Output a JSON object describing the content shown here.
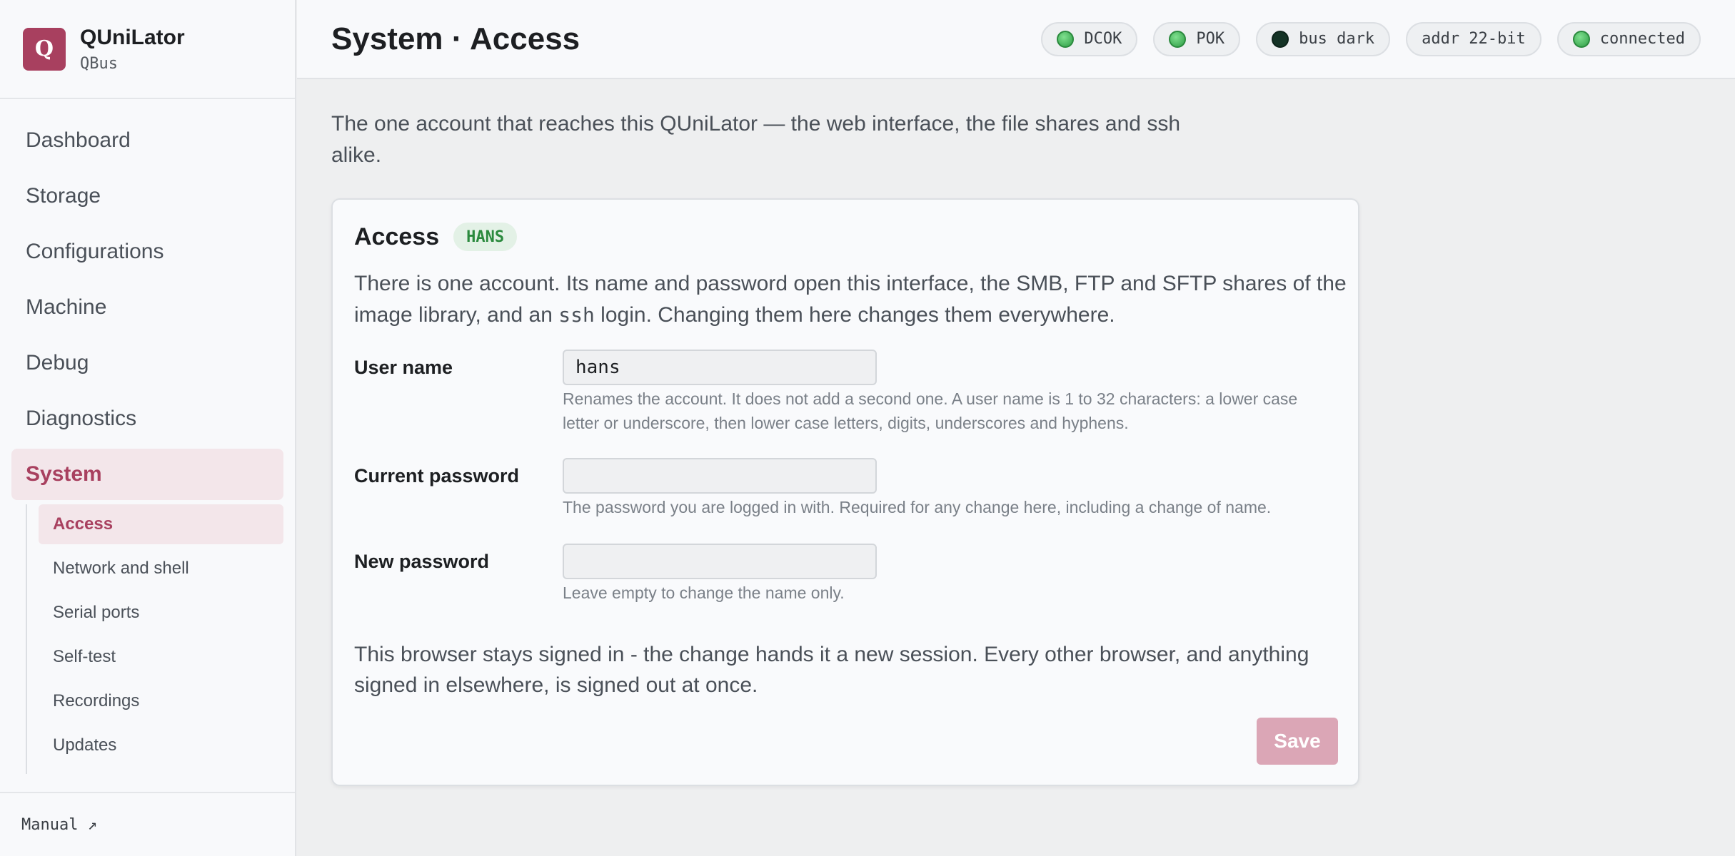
{
  "brand": {
    "logo_letter": "Q",
    "name": "QUniLator",
    "subtitle": "QBus"
  },
  "sidebar": {
    "items": [
      {
        "label": "Dashboard",
        "active": false
      },
      {
        "label": "Storage",
        "active": false
      },
      {
        "label": "Configurations",
        "active": false
      },
      {
        "label": "Machine",
        "active": false
      },
      {
        "label": "Debug",
        "active": false
      },
      {
        "label": "Diagnostics",
        "active": false
      },
      {
        "label": "System",
        "active": true
      }
    ],
    "subitems": [
      {
        "label": "Access",
        "active": true
      },
      {
        "label": "Network and shell",
        "active": false
      },
      {
        "label": "Serial ports",
        "active": false
      },
      {
        "label": "Self-test",
        "active": false
      },
      {
        "label": "Recordings",
        "active": false
      },
      {
        "label": "Updates",
        "active": false
      }
    ],
    "footer_link": "Manual ↗"
  },
  "header": {
    "title": "System · Access",
    "chips": [
      {
        "label": "DCOK",
        "indicator": "green"
      },
      {
        "label": "POK",
        "indicator": "green"
      },
      {
        "label": "bus dark",
        "indicator": "dark"
      },
      {
        "label": "addr 22-bit",
        "indicator": "none"
      },
      {
        "label": "connected",
        "indicator": "green"
      }
    ]
  },
  "intro": "The one account that reaches this QUniLator — the web interface, the file shares and ssh alike.",
  "card": {
    "title": "Access",
    "badge": "HANS",
    "desc_before": "There is one account. Its name and password open this interface, the SMB, FTP and SFTP shares of the image library, and an ",
    "desc_code": "ssh",
    "desc_after": " login. Changing them here changes them everywhere.",
    "fields": {
      "username": {
        "label": "User name",
        "value": "hans",
        "help": "Renames the account. It does not add a second one. A user name is 1 to 32 characters: a lower case letter or underscore, then lower case letters, digits, underscores and hyphens."
      },
      "current_password": {
        "label": "Current password",
        "value": "",
        "help": "The password you are logged in with. Required for any change here, including a change of name."
      },
      "new_password": {
        "label": "New password",
        "value": "",
        "help": "Leave empty to change the name only."
      }
    },
    "note": "This browser stays signed in - the change hands it a new session. Every other browser, and anything signed in elsewhere, is signed out at once.",
    "save_label": "Save"
  },
  "colors": {
    "accent": "#a8405f",
    "accent_bg": "#f3e6ea",
    "status_green": "#2b8a3e",
    "save_disabled": "#dba6b6"
  }
}
